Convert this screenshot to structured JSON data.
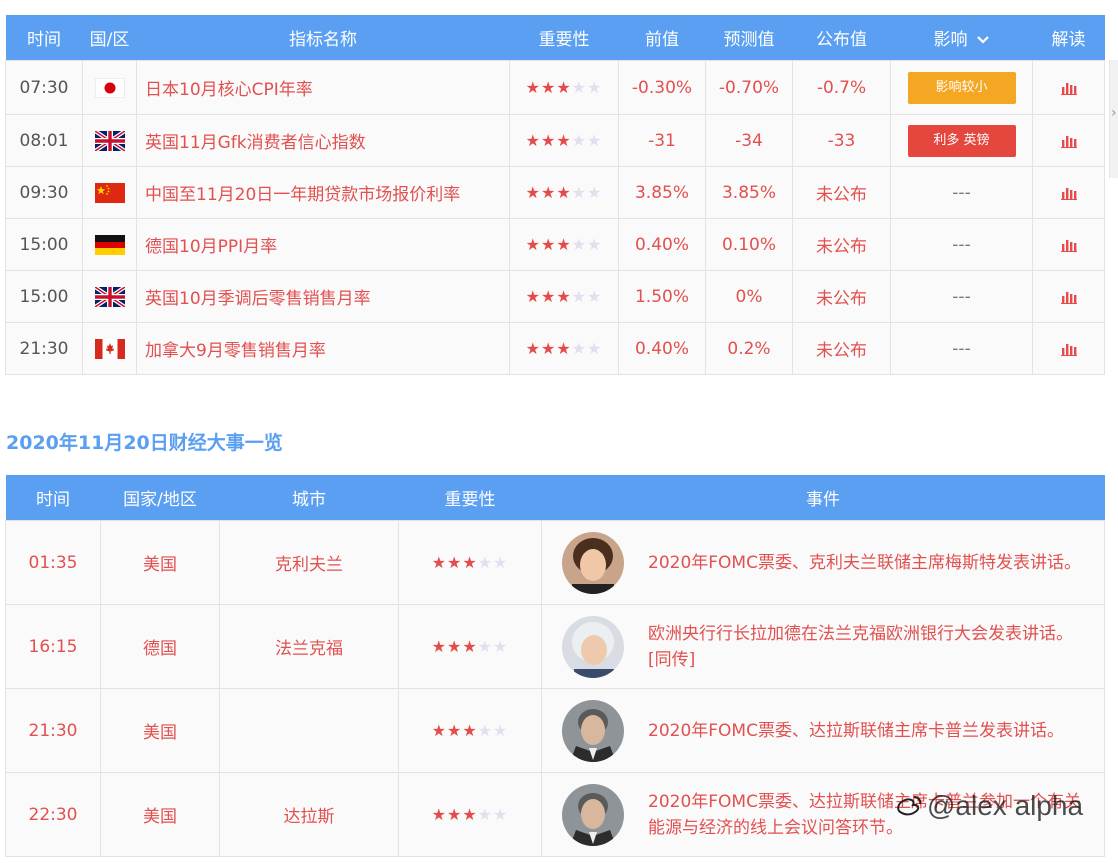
{
  "calendar": {
    "headers": {
      "time": "时间",
      "region": "国/区",
      "indicator": "指标名称",
      "importance": "重要性",
      "previous": "前值",
      "forecast": "预测值",
      "actual": "公布值",
      "impact": "影响",
      "interpret": "解读"
    },
    "rows": [
      {
        "time": "07:30",
        "flag": "jp-flag",
        "name": "日本10月核心CPI年率",
        "stars": 3,
        "previous": "-0.30%",
        "forecast": "-0.70%",
        "actual": "-0.7%",
        "impact": "影响较小",
        "impact_color": "#f5a623"
      },
      {
        "time": "08:01",
        "flag": "uk-flag",
        "name": "英国11月Gfk消费者信心指数",
        "stars": 3,
        "previous": "-31",
        "forecast": "-34",
        "actual": "-33",
        "impact": "利多 英镑",
        "impact_color": "#e5473f"
      },
      {
        "time": "09:30",
        "flag": "cn-flag",
        "name": "中国至11月20日一年期贷款市场报价利率",
        "stars": 3,
        "previous": "3.85%",
        "forecast": "3.85%",
        "actual": "未公布",
        "impact": "---",
        "impact_color": ""
      },
      {
        "time": "15:00",
        "flag": "de-flag",
        "name": "德国10月PPI月率",
        "stars": 3,
        "previous": "0.40%",
        "forecast": "0.10%",
        "actual": "未公布",
        "impact": "---",
        "impact_color": ""
      },
      {
        "time": "15:00",
        "flag": "uk-flag",
        "name": "英国10月季调后零售销售月率",
        "stars": 3,
        "previous": "1.50%",
        "forecast": "0%",
        "actual": "未公布",
        "impact": "---",
        "impact_color": ""
      },
      {
        "time": "21:30",
        "flag": "ca-flag",
        "name": "加拿大9月零售销售月率",
        "stars": 3,
        "previous": "0.40%",
        "forecast": "0.2%",
        "actual": "未公布",
        "impact": "---",
        "impact_color": ""
      }
    ]
  },
  "side_scroll_glyph": "›",
  "events_section": {
    "title": "2020年11月20日财经大事一览",
    "headers": {
      "time": "时间",
      "country": "国家/地区",
      "city": "城市",
      "importance": "重要性",
      "event": "事件"
    },
    "rows": [
      {
        "time": "01:35",
        "country": "美国",
        "city": "克利夫兰",
        "stars": 3,
        "event": "2020年FOMC票委、克利夫兰联储主席梅斯特发表讲话。",
        "avatar": "woman-short-hair-portrait"
      },
      {
        "time": "16:15",
        "country": "德国",
        "city": "法兰克福",
        "stars": 3,
        "event": "欧洲央行行长拉加德在法兰克福欧洲银行大会发表讲话。[同传]",
        "avatar": "woman-white-hair-portrait"
      },
      {
        "time": "21:30",
        "country": "美国",
        "city": "",
        "stars": 3,
        "event": "2020年FOMC票委、达拉斯联储主席卡普兰发表讲话。",
        "avatar": "man-suit-portrait"
      },
      {
        "time": "22:30",
        "country": "美国",
        "city": "达拉斯",
        "stars": 3,
        "event": "2020年FOMC票委、达拉斯联储主席卡普兰参加一个有关能源与经济的线上会议问答环节。",
        "avatar": "man-suit-portrait"
      }
    ]
  },
  "watermark": "@alex alpha",
  "colors": {
    "header_blue": "#5b9ff2",
    "value_red": "#e25050",
    "star_on": "#e64b4b",
    "star_off": "#dde2ec"
  }
}
